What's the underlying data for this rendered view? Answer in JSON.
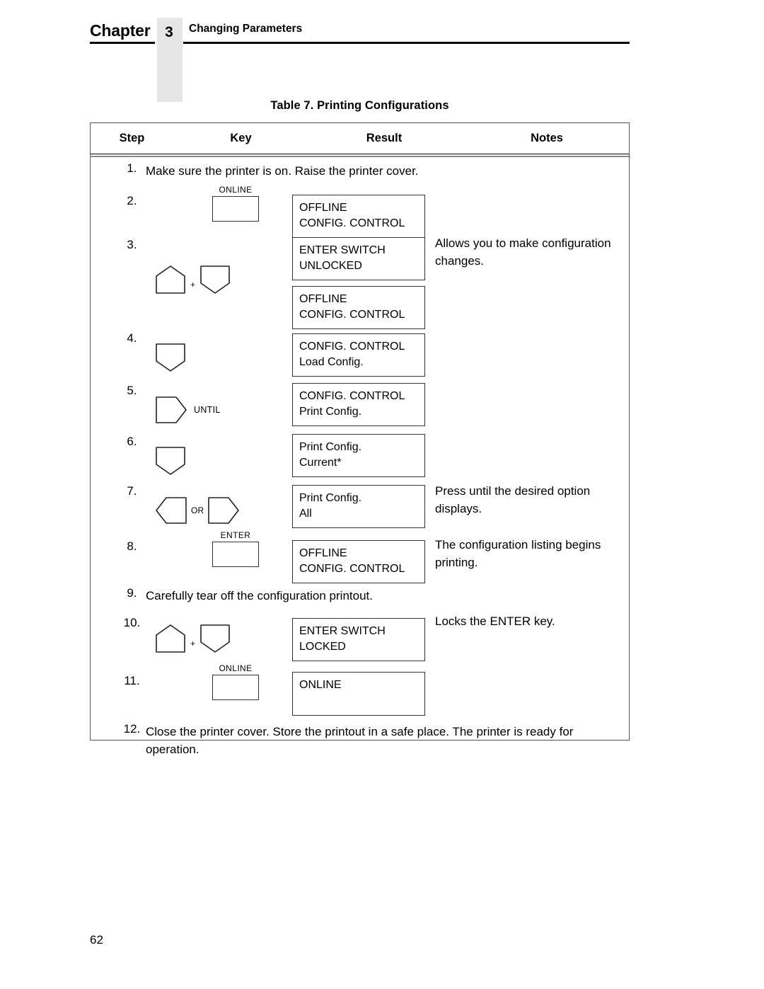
{
  "header": {
    "chapter_label": "Chapter",
    "chapter_number": "3",
    "chapter_title": "Changing Parameters"
  },
  "table": {
    "caption": "Table 7. Printing Configurations",
    "columns": {
      "step": "Step",
      "key": "Key",
      "result": "Result",
      "notes": "Notes"
    },
    "rows": [
      {
        "step": "1.",
        "type": "fulltext",
        "text": "Make sure the printer is on. Raise the printer cover."
      },
      {
        "step": "2.",
        "type": "keyed",
        "key": {
          "kind": "rect",
          "cap": "ONLINE"
        },
        "results": [
          {
            "lines": [
              "OFFLINE",
              "CONFIG. CONTROL"
            ]
          }
        ],
        "notes": ""
      },
      {
        "step": "3.",
        "type": "keyed",
        "key": {
          "kind": "combo",
          "first": "up",
          "sep": "+",
          "second": "down"
        },
        "results": [
          {
            "lines": [
              "ENTER SWITCH",
              "UNLOCKED"
            ]
          },
          {
            "lines": [
              "OFFLINE",
              "CONFIG. CONTROL"
            ]
          }
        ],
        "notes": "Allows you to make configuration changes."
      },
      {
        "step": "4.",
        "type": "keyed",
        "key": {
          "kind": "single",
          "shape": "down"
        },
        "results": [
          {
            "lines": [
              "CONFIG. CONTROL",
              "Load Config."
            ]
          }
        ],
        "notes": ""
      },
      {
        "step": "5.",
        "type": "keyed",
        "key": {
          "kind": "single",
          "shape": "right",
          "label": "UNTIL"
        },
        "results": [
          {
            "lines": [
              "CONFIG. CONTROL",
              "Print Config."
            ]
          }
        ],
        "notes": ""
      },
      {
        "step": "6.",
        "type": "keyed",
        "key": {
          "kind": "single",
          "shape": "down"
        },
        "results": [
          {
            "lines": [
              "Print Config.",
              "Current*"
            ]
          }
        ],
        "notes": ""
      },
      {
        "step": "7.",
        "type": "keyed",
        "key": {
          "kind": "combo",
          "first": "left",
          "sep": "OR",
          "second": "right"
        },
        "results": [
          {
            "lines": [
              "Print Config.",
              "All"
            ]
          }
        ],
        "notes": "Press until the desired option displays."
      },
      {
        "step": "8.",
        "type": "keyed",
        "key": {
          "kind": "rect",
          "cap": "ENTER"
        },
        "results": [
          {
            "lines": [
              "OFFLINE",
              "CONFIG. CONTROL"
            ]
          }
        ],
        "notes": "The configuration listing begins printing."
      },
      {
        "step": "9.",
        "type": "fulltext",
        "text": "Carefully tear off the configuration printout."
      },
      {
        "step": "10.",
        "type": "keyed",
        "key": {
          "kind": "combo",
          "first": "up",
          "sep": "+",
          "second": "down"
        },
        "results": [
          {
            "lines": [
              "ENTER SWITCH",
              "LOCKED"
            ]
          }
        ],
        "notes": "Locks the ENTER key."
      },
      {
        "step": "11.",
        "type": "keyed",
        "key": {
          "kind": "rect",
          "cap": "ONLINE"
        },
        "results": [
          {
            "lines": [
              "ONLINE",
              ""
            ]
          }
        ],
        "notes": ""
      },
      {
        "step": "12.",
        "type": "fulltext",
        "text": "Close the printer cover. Store the printout in a safe place. The printer is ready for operation."
      }
    ]
  },
  "footer": {
    "page_number": "62"
  },
  "colors": {
    "text": "#000000",
    "chapter_block": "#e6e6e6",
    "rule": "#000000",
    "box_border": "#333333"
  }
}
